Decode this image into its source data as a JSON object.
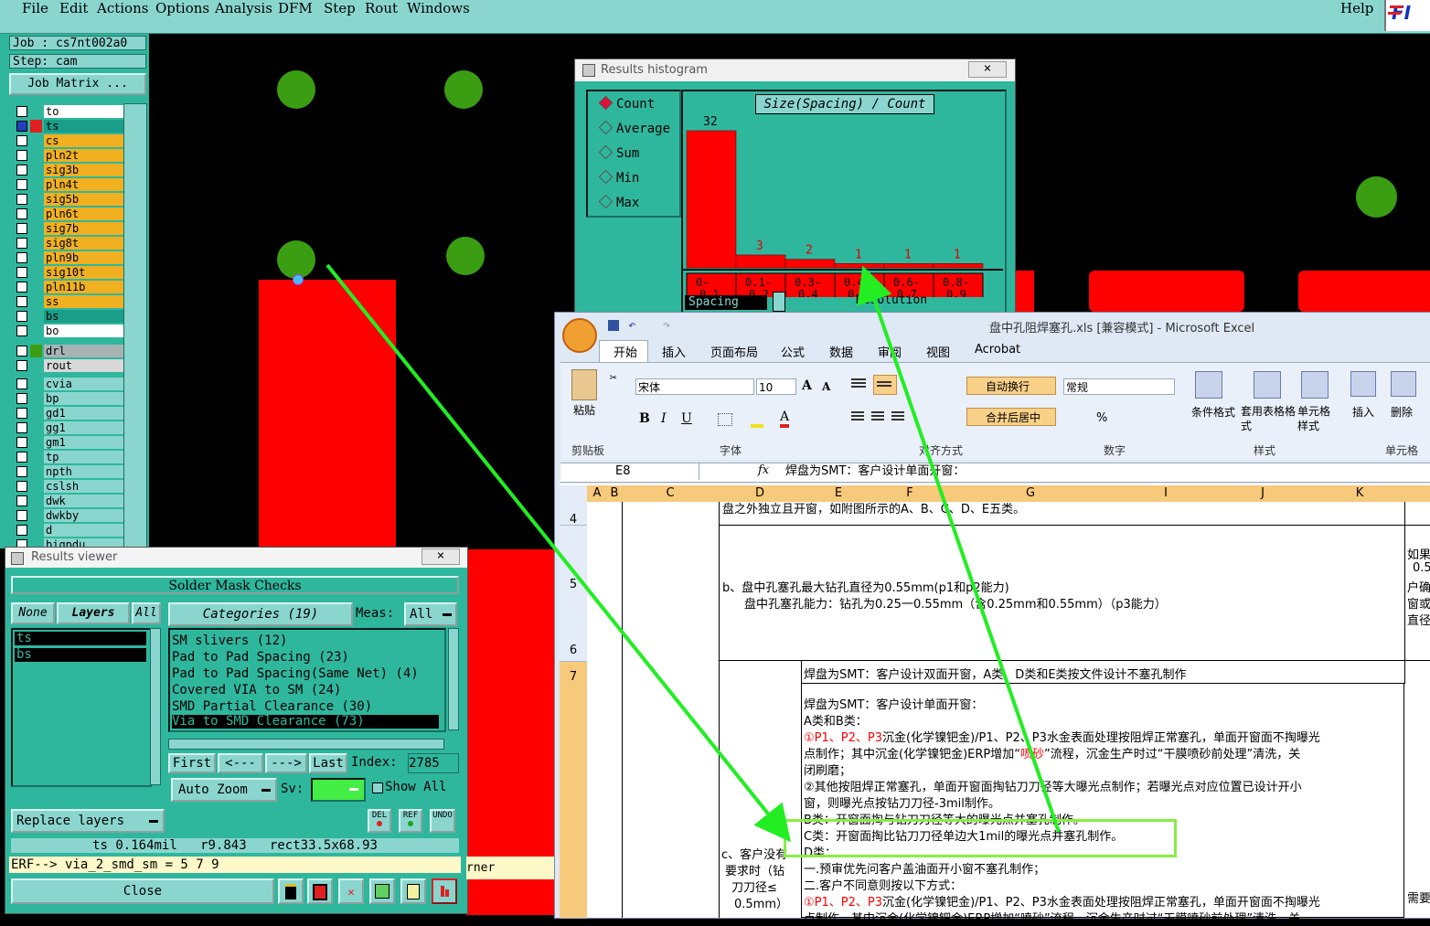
{
  "menubar": {
    "items": [
      "File",
      "Edit",
      "Actions",
      "Options",
      "Analysis",
      "DFM",
      "Step",
      "Rout",
      "Windows"
    ],
    "help": "Help",
    "logo": "FI"
  },
  "leftpanel": {
    "job": "Job : cs7nt002a0",
    "step": "Step: cam",
    "job_matrix": "Job Matrix ...",
    "layers_top": [
      "to",
      "ts",
      "cs",
      "pln2t",
      "sig3b",
      "pln4t",
      "sig5b",
      "pln6t",
      "sig7b",
      "sig8t",
      "pln9b",
      "sig10t",
      "pln11b",
      "ss",
      "bs",
      "bo"
    ],
    "layers_drill": [
      "drl",
      "rout"
    ],
    "layers_misc": [
      "cvia",
      "bp",
      "gd1",
      "gg1",
      "gm1",
      "tp",
      "npth",
      "cslsh",
      "dwk",
      "dwkby",
      "d",
      "bigpdu"
    ]
  },
  "histogram": {
    "title": "Results histogram",
    "close": "×",
    "modes": [
      "Count",
      "Average",
      "Sum",
      "Min",
      "Max"
    ],
    "chart_title": "Size(Spacing) / Count",
    "spacing_label": "Spacing",
    "resolution_label": "Resolution",
    "chart_data": {
      "type": "bar",
      "title": "Size(Spacing) / Count",
      "categories": [
        "0-0.1",
        "0.1-0.2",
        "0.3-0.4",
        "0.4-0.5",
        "0.6-0.7",
        "0.8-0.9"
      ],
      "values": [
        32,
        3,
        2,
        1,
        1,
        1
      ],
      "ylim": [
        0,
        32
      ]
    },
    "bins_top": [
      "0-",
      "0.1-",
      "0.3-",
      "0.4-",
      "0.6-",
      "0.8-"
    ],
    "bins_bottom": [
      "0.1",
      "0.2",
      "0.4",
      "0.5",
      "0.7",
      "0.9"
    ]
  },
  "resview": {
    "title": "Results viewer",
    "close": "×",
    "header": "Solder Mask Checks",
    "none": "None",
    "layers": "Layers",
    "all": "All",
    "categories": "Categories (19)",
    "meas": "Meas:",
    "meas_val": "All",
    "layer_items": [
      "ts",
      "bs"
    ],
    "checks": [
      "SM slivers (12)",
      "Pad to Pad Spacing (23)",
      "Pad to Pad Spacing(Same Net) (4)",
      "Covered VIA to SM (24)",
      "SMD Partial Clearance (30)",
      "Via to SMD Clearance (73)"
    ],
    "first": "First",
    "prev": "<---",
    "next": "--->",
    "last": "Last",
    "index_label": "Index:",
    "index_val": "2785",
    "auto_zoom": "Auto Zoom",
    "sv": "Sv:",
    "show_all": "Show All",
    "replace_layers": "Replace layers",
    "del": "DEL",
    "ref": "REF",
    "undo": "UNDO",
    "status": "ts 0.164mil   r9.843   rect33.5x68.93",
    "erf": "ERF--> via_2_smd_sm = 5 7 9",
    "close_btn": "Close",
    "corner": "rner"
  },
  "excel": {
    "title": "盘中孔阻焊塞孔.xls  [兼容模式] - Microsoft Excel",
    "tabs": [
      "开始",
      "插入",
      "页面布局",
      "公式",
      "数据",
      "审阅",
      "视图",
      "Acrobat"
    ],
    "font_name": "宋体",
    "font_size": "10",
    "number_format": "常规",
    "paste": "粘贴",
    "wrap": "自动换行",
    "merge": "合并后居中",
    "cond_format": "条件格式",
    "table_format": "套用表格格式",
    "cell_style": "单元格样式",
    "insert": "插入",
    "delete": "删除",
    "groups": [
      "剪贴板",
      "字体",
      "对齐方式",
      "数字",
      "样式",
      "单元格"
    ],
    "namebox": "E8",
    "formula": "焊盘为SMT：客户设计单面开窗：",
    "fx": "fx",
    "columns": [
      "A",
      "B",
      "C",
      "D",
      "E",
      "F",
      "G",
      "I",
      "J",
      "K"
    ],
    "rows": [
      "4",
      "5",
      "6",
      "7"
    ],
    "row4_text": "盘之外独立且开窗，如附图所示的A、B、C、D、E五类。",
    "row5_line1": "b、盘中孔塞孔最大钻孔直径为0.55mm(p1和p2能力)",
    "row5_line2": "盘中孔塞孔能力：钻孔为0.25一0.55mm（含0.25mm和0.55mm）（p3能力）",
    "right_col": [
      "如果",
      "0.5",
      "户确",
      "窗或",
      "直径",
      "需要"
    ],
    "row7_text": "焊盘为SMT：客户设计双面开窗，A类、D类和E类按文件设计不塞孔制作",
    "e8_lines": {
      "l1": "焊盘为SMT：客户设计单面开窗：",
      "l2": "A类和B类：",
      "l3_red": "①P1、P2、P3",
      "l3": "沉金(化学镍钯金)/P1、P2、P3水金表面处理按阻焊正常塞孔，单面开窗面不掏曝光",
      "l4a": "点制作；其中沉金(化学镍钯金)ERP增加“",
      "l4_red": "喷砂",
      "l4b": "”流程，沉金生产时过“干膜喷砂前处理”清洗，关",
      "l5": "闭刷磨；",
      "l6": "②其他按阻焊正常塞孔，单面开窗面掏钻刀刀径等大曝光点制作；若曝光点对应位置已设计开小",
      "l7": "窗，则曝光点按钻刀刀径-3mil制作。",
      "l8": "B类：开窗面掏与钻刀刀径等大的曝光点并塞孔制作。",
      "l9": "C类：开窗面掏比钻刀刀径单边大1mil的曝光点并塞孔制作。",
      "l10": "D类：",
      "l11": "一.预审优先问客户盖油面开小窗不塞孔制作；",
      "l12": "二.客户不同意则按以下方式：",
      "l13_red": "①P1、P2、P3",
      "l13": "沉金(化学镍钯金)/P1、P2、P3水金表面处理按阻焊正常塞孔，单面开窗面不掏曝光",
      "l14": "点制作，其中沉金(化学镍钯金)ERP增加“喷砂”流程，沉金生产时过“干膜喷砂前处理”清洗，关"
    },
    "c_cell": [
      "c、客户没有",
      "要求时（钻",
      "刀刀径≤",
      "0.5mm）"
    ]
  },
  "colors": {
    "panel": "#2fb79e",
    "light": "#8ad6cf",
    "pad": "#3a9d12",
    "rect": "#ff0000",
    "arrow": "#22ee22",
    "orange": "#f0b020"
  }
}
